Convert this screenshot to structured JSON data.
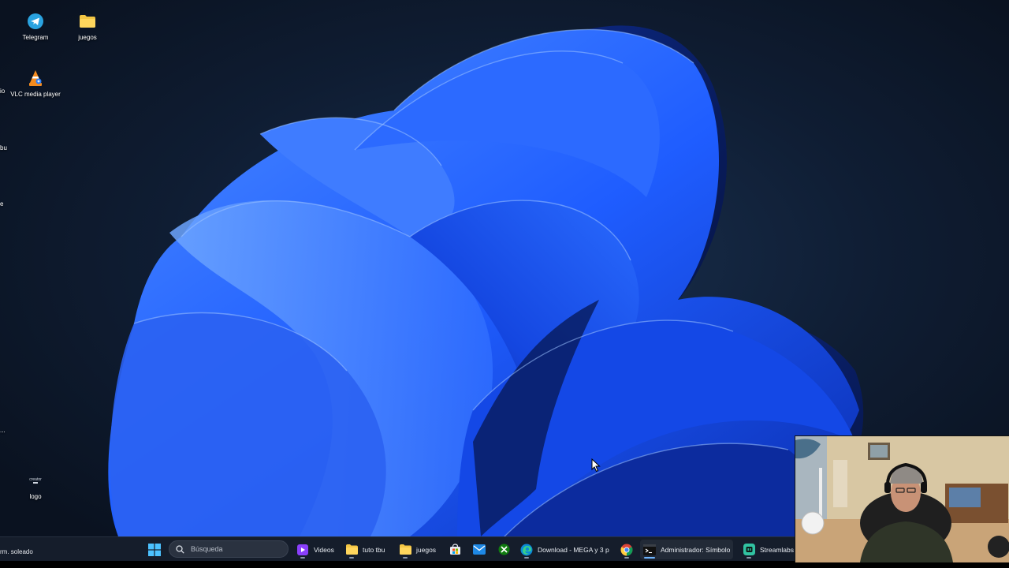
{
  "desktop": {
    "icons": [
      {
        "id": "telegram",
        "label": "Telegram",
        "icon": "telegram-icon"
      },
      {
        "id": "juegos",
        "label": "juegos",
        "icon": "folder-icon"
      },
      {
        "id": "vlc",
        "label": "VLC media player",
        "icon": "vlc-icon"
      },
      {
        "id": "logo",
        "label": "logo",
        "icon": "image-file-icon"
      }
    ],
    "clipped_labels": [
      "io",
      "bu",
      "e",
      "...",
      "..."
    ],
    "logo_thumb_text": "creator"
  },
  "taskbar": {
    "weather": "rm. soleado",
    "start_icon": "windows-start-icon",
    "search": {
      "placeholder": "Búsqueda",
      "icon": "search-icon"
    },
    "items": [
      {
        "label": "Videos",
        "icon": "video-player-icon"
      },
      {
        "label": "tuto tbu",
        "icon": "folder-icon"
      },
      {
        "label": "juegos",
        "icon": "folder-icon"
      },
      {
        "label": "",
        "icon": "store-icon"
      },
      {
        "label": "",
        "icon": "mail-icon"
      },
      {
        "label": "",
        "icon": "xbox-icon"
      },
      {
        "label": "Download - MEGA y 3 p",
        "icon": "edge-icon"
      },
      {
        "label": "",
        "icon": "chrome-icon"
      },
      {
        "label": "Administrador: Símbolo",
        "icon": "terminal-icon"
      },
      {
        "label": "Streamlabs",
        "icon": "streamlabs-icon"
      }
    ]
  },
  "colors": {
    "wallpaper_bg": "#0b1424",
    "bloom_blue": "#1f5dff",
    "taskbar_bg": "#151d2b",
    "folder_yellow": "#f3c644",
    "accent": "#6cb4ff"
  }
}
